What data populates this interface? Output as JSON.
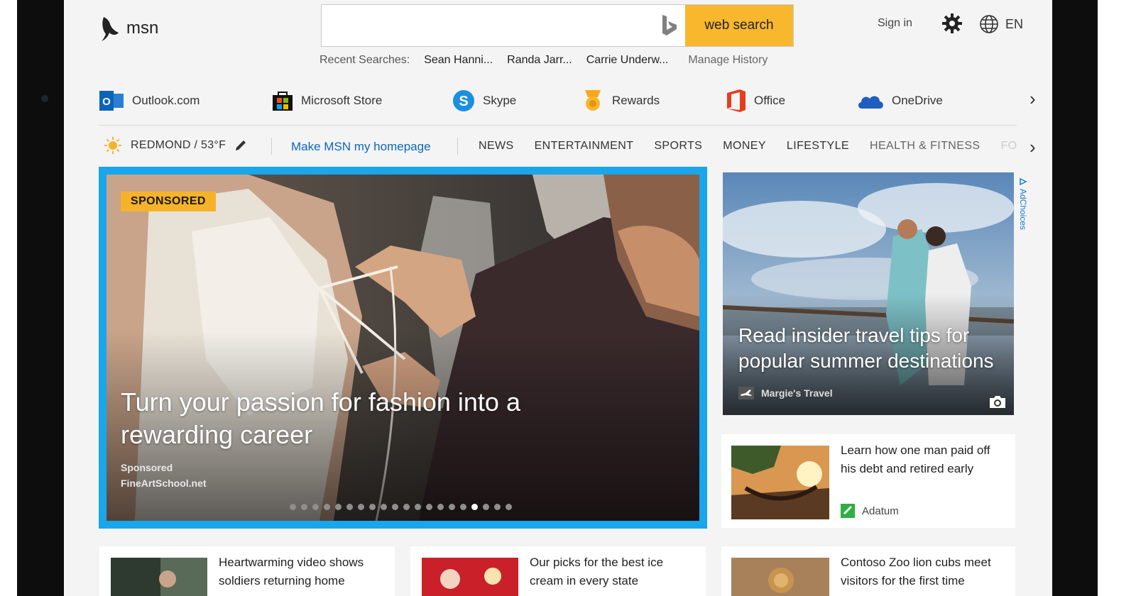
{
  "header": {
    "logo_text": "msn",
    "search": {
      "placeholder": "",
      "value": "",
      "button_label": "web search"
    },
    "recent_label": "Recent Searches:",
    "recent_items": [
      "Sean Hanni...",
      "Randa Jarr...",
      "Carrie Underw..."
    ],
    "manage_history": "Manage History",
    "signin": "Sign in",
    "language": "EN"
  },
  "apps": {
    "items": [
      {
        "label": "Outlook.com",
        "icon": "outlook-icon"
      },
      {
        "label": "Microsoft Store",
        "icon": "store-icon"
      },
      {
        "label": "Skype",
        "icon": "skype-icon"
      },
      {
        "label": "Rewards",
        "icon": "rewards-icon"
      },
      {
        "label": "Office",
        "icon": "office-icon"
      },
      {
        "label": "OneDrive",
        "icon": "onedrive-icon"
      }
    ]
  },
  "nav": {
    "weather": "REDMOND / 53°F",
    "homepage": "Make MSN my homepage",
    "links": [
      "NEWS",
      "ENTERTAINMENT",
      "SPORTS",
      "MONEY",
      "LIFESTYLE",
      "HEALTH & FITNESS",
      "FO"
    ]
  },
  "hero": {
    "tag": "SPONSORED",
    "title": "Turn your passion for fashion into a rewarding career",
    "label": "Sponsored",
    "source": "FineArtSchool.net",
    "dot_count": 20,
    "active_dot": 16
  },
  "travel": {
    "title": "Read insider travel tips for popular summer destinations",
    "source": "Margie's Travel",
    "adchoices": "AdChoices"
  },
  "cards": {
    "debt": {
      "title": "Learn how one man paid off his debt and retired early",
      "source": "Adatum"
    },
    "bottom": [
      {
        "title": "Heartwarming video shows soldiers returning home"
      },
      {
        "title": "Our picks for the best ice cream in every state"
      },
      {
        "title": "Contoso Zoo lion cubs meet visitors for the first time"
      }
    ]
  },
  "colors": {
    "accent": "#f8b72d",
    "hero_border": "#1aa6ea",
    "link": "#0b67c1"
  }
}
